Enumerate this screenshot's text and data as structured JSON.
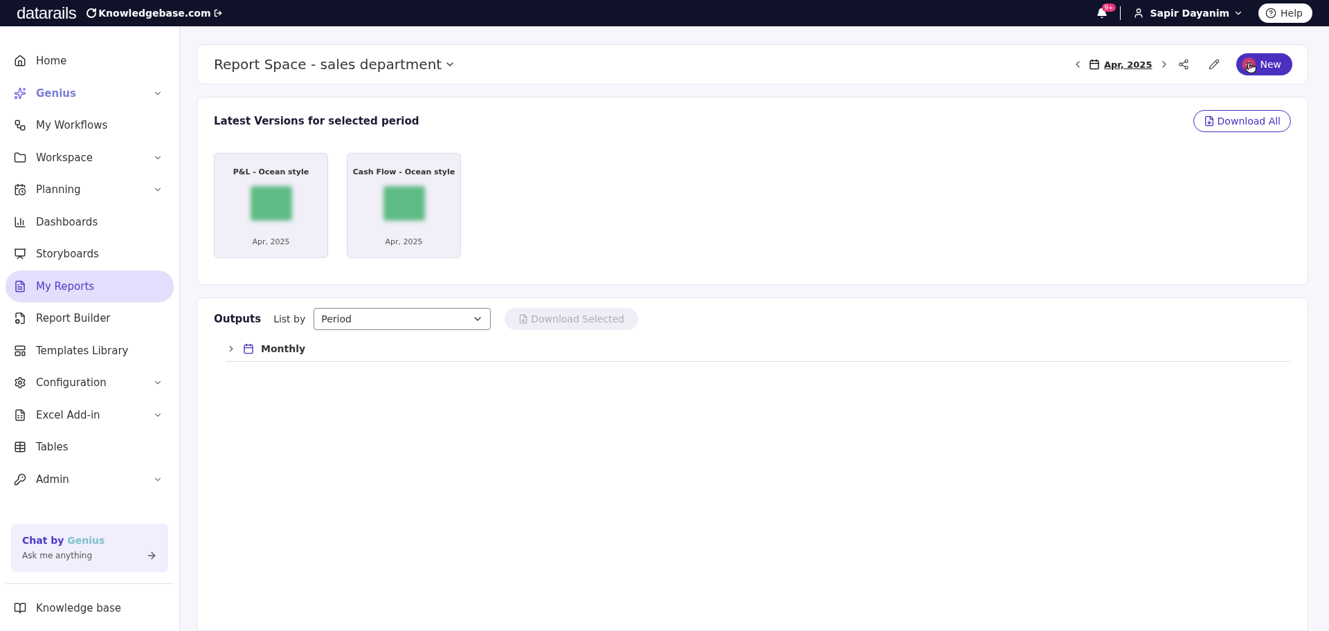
{
  "topbar": {
    "logo": "datarails",
    "workspace": "Knowledgebase.com",
    "notifications_badge": "9+",
    "user": "Sapir Dayanim",
    "help": "Help"
  },
  "sidebar": {
    "items": [
      {
        "label": "Home",
        "kind": "link",
        "selected": false
      },
      {
        "label": "Genius",
        "kind": "ai-group",
        "selected": false
      },
      {
        "label": "My Workflows",
        "kind": "link",
        "selected": false
      },
      {
        "label": "Workspace",
        "kind": "group",
        "selected": false
      },
      {
        "label": "Planning",
        "kind": "group",
        "selected": false
      },
      {
        "label": "Dashboards",
        "kind": "link",
        "selected": false
      },
      {
        "label": "Storyboards",
        "kind": "link",
        "selected": false
      },
      {
        "label": "My Reports",
        "kind": "link",
        "selected": true
      },
      {
        "label": "Report Builder",
        "kind": "link",
        "selected": false
      },
      {
        "label": "Templates Library",
        "kind": "link",
        "selected": false
      },
      {
        "label": "Configuration",
        "kind": "group",
        "selected": false
      },
      {
        "label": "Excel Add-in",
        "kind": "group",
        "selected": false
      },
      {
        "label": "Tables",
        "kind": "link",
        "selected": false
      },
      {
        "label": "Admin",
        "kind": "group",
        "selected": false
      }
    ],
    "chat": {
      "title": "Chat by **Genius**",
      "subtitle": "Ask me anything"
    },
    "footer_item": "Knowledge base"
  },
  "header": {
    "title": "Report Space - sales department",
    "period": "Apr, 2025",
    "new_button": "New"
  },
  "latest": {
    "title": "Latest Versions for selected period",
    "download_all": "Download All",
    "files": [
      {
        "name": "P&L - Ocean style",
        "period": "Apr, 2025"
      },
      {
        "name": "Cash Flow - Ocean style",
        "period": "Apr, 2025"
      }
    ]
  },
  "outputs": {
    "title": "Outputs",
    "list_by_label": "List by",
    "list_by_value": "Period",
    "download_selected": "Download Selected",
    "download_selected_disabled": true,
    "groups": [
      {
        "label": "Monthly",
        "expanded": false
      }
    ]
  }
}
